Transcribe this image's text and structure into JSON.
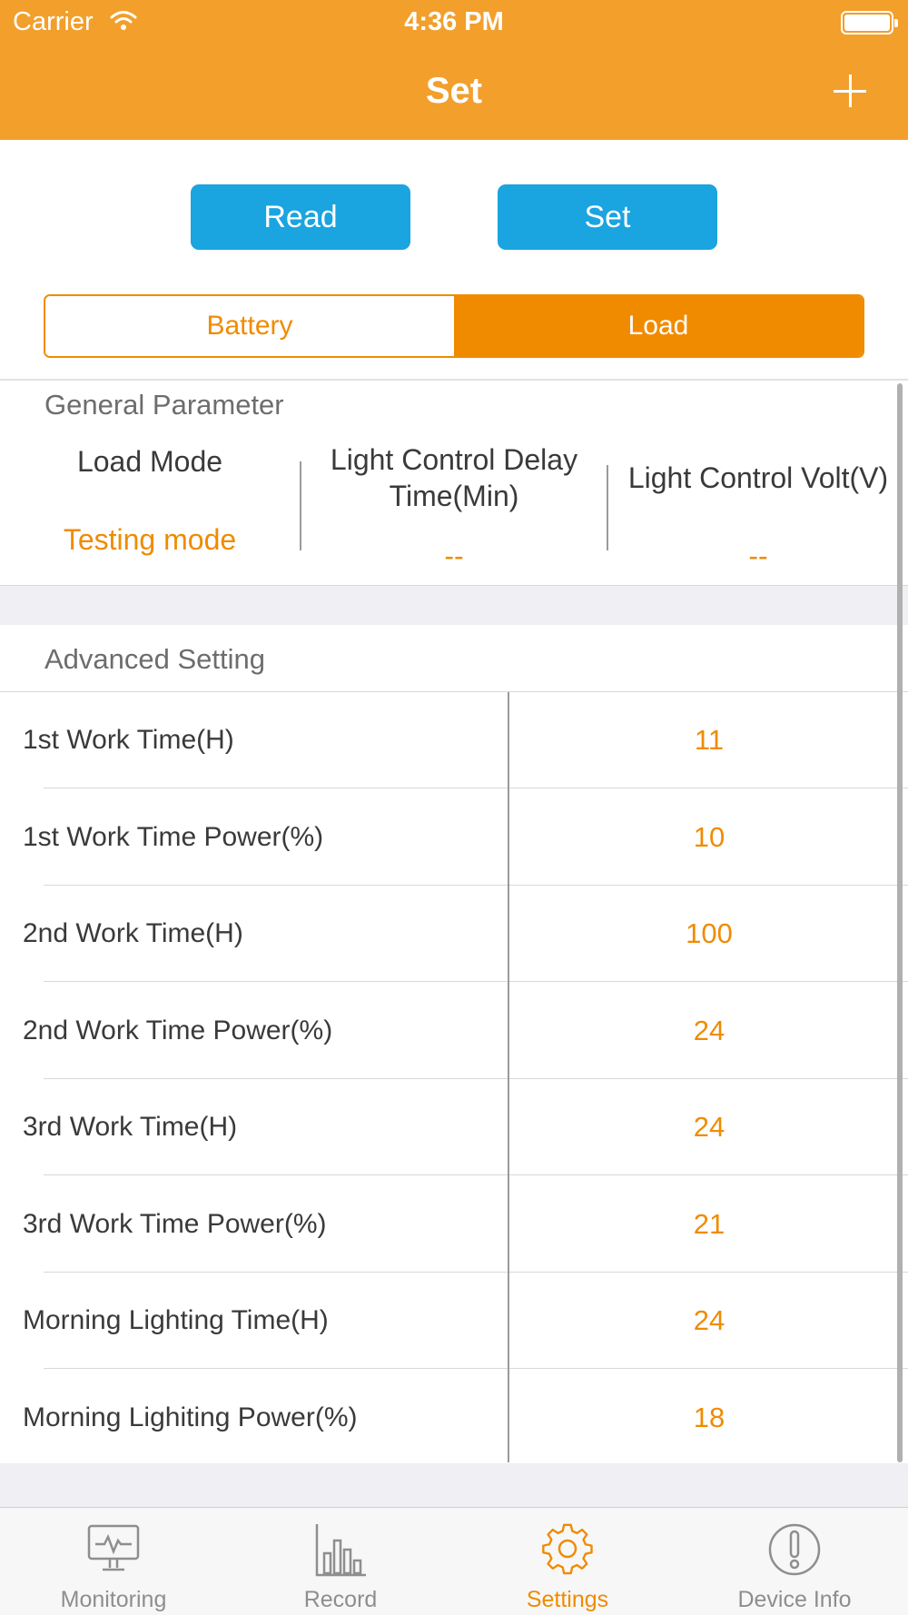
{
  "status_bar": {
    "carrier": "Carrier",
    "time": "4:36 PM"
  },
  "nav": {
    "title": "Set"
  },
  "actions": {
    "read_label": "Read",
    "set_label": "Set"
  },
  "segment": {
    "battery_label": "Battery",
    "load_label": "Load",
    "selected": "Load"
  },
  "general": {
    "title": "General Parameter",
    "load_mode": {
      "label": "Load Mode",
      "value": "Testing mode"
    },
    "delay_time": {
      "label": "Light Control Delay Time(Min)",
      "value": "--"
    },
    "volt": {
      "label": "Light Control Volt(V)",
      "value": "--"
    }
  },
  "advanced": {
    "title": "Advanced Setting",
    "rows": [
      {
        "label": "1st Work Time(H)",
        "value": "11"
      },
      {
        "label": "1st Work Time Power(%)",
        "value": "10"
      },
      {
        "label": "2nd Work Time(H)",
        "value": "100"
      },
      {
        "label": "2nd Work Time Power(%)",
        "value": "24"
      },
      {
        "label": "3rd Work Time(H)",
        "value": "24"
      },
      {
        "label": "3rd Work Time Power(%)",
        "value": "21"
      },
      {
        "label": "Morning Lighting Time(H)",
        "value": "24"
      },
      {
        "label": "Morning Lighiting Power(%)",
        "value": "18"
      }
    ]
  },
  "tabbar": {
    "tabs": [
      {
        "label": "Monitoring",
        "icon": "monitor-icon"
      },
      {
        "label": "Record",
        "icon": "bar-chart-icon"
      },
      {
        "label": "Settings",
        "icon": "gear-icon"
      },
      {
        "label": "Device Info",
        "icon": "info-exclamation-icon"
      }
    ],
    "active": "Settings"
  },
  "colors": {
    "accent": "#f29f2c",
    "selected_orange": "#f08b00",
    "button_blue": "#1aa4e0"
  }
}
